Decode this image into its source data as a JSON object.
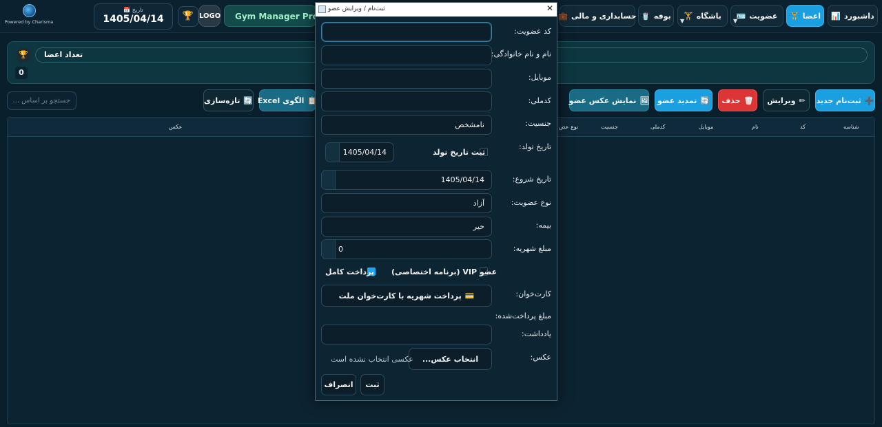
{
  "brand": {
    "powered": "Powered by Charisma"
  },
  "header": {
    "date_label": "📅 تاریخ",
    "date_value": "1405/04/14",
    "logo": "LOGO",
    "app_name": "Gym Manager Pro"
  },
  "nav": {
    "dashboard": "داشبورد",
    "members": "اعضا",
    "membership": "عضویت",
    "club": "باشگاه",
    "buffet": "بوفه",
    "accounting": "حسابداری و مالی"
  },
  "count_panel": {
    "title": "تعداد اعضا",
    "count": "0"
  },
  "toolbar": {
    "new": "ثبت‌نام جدید",
    "edit": "ویرایش",
    "delete": "حذف",
    "renew": "تمدید عضو",
    "show_photo": "نمایش عکس عضو",
    "template": "الگوی Excel",
    "refresh": "تازه‌سازی",
    "search_placeholder": "جستجو بر اساس ..."
  },
  "table": {
    "columns": [
      "شناسه",
      "کد",
      "نام",
      "موبایل",
      "کدملی",
      "جنسیت",
      "نوع عض",
      "عکس"
    ]
  },
  "dialog": {
    "title": "ثبت‌نام / ویرایش عضو",
    "labels": {
      "code": "کد عضویت:",
      "name": "نام و نام خانوادگی:",
      "mobile": "موبایل:",
      "national_id": "کدملی:",
      "gender": "جنسیت:",
      "birth": "تاریخ تولد:",
      "start": "تاریخ شروع:",
      "type": "نوع عضویت:",
      "insurance": "بیمه:",
      "fee": "مبلغ شهریه:",
      "card": "کارت‌خوان:",
      "paid": "مبلغ پرداخت‌شده:",
      "note": "یادداشت:",
      "photo": "عکس:"
    },
    "values": {
      "code": "",
      "name": "",
      "mobile": "",
      "national_id": "",
      "gender": "نامشخص",
      "birth": "1405/04/14",
      "start": "1405/04/14",
      "type": "آزاد",
      "insurance": "خیر",
      "fee": "0",
      "note": ""
    },
    "birth_checkbox": "ثبت تاریخ تولد",
    "vip_checkbox": "عضو VIP (برنامه اختصاصی)",
    "full_pay_checkbox": "پرداخت کامل",
    "card_button": "پرداخت شهریه با کارت‌خوان ملت",
    "no_photo": "عکسی انتخاب نشده است",
    "choose_photo": "انتخاب عکس...",
    "save": "ثبت",
    "cancel": "انصراف"
  }
}
